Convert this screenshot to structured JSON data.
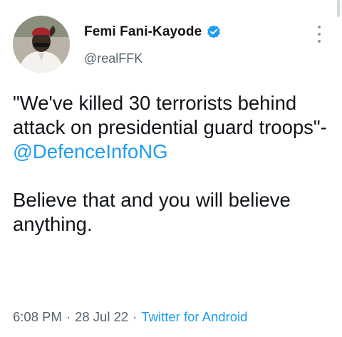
{
  "author": {
    "display_name": "Femi Fani-Kayode",
    "handle": "@realFFK",
    "verified": true
  },
  "tweet": {
    "quote": "\"We've killed 30 terrorists behind attack on presidential guard troops\"-",
    "mention": "@DefenceInfoNG",
    "paragraph_2": "Believe that and you will believe anything."
  },
  "meta": {
    "time": "6:08 PM",
    "separator": "·",
    "date": "28 Jul 22",
    "source": "Twitter for Android"
  },
  "icons": {
    "verified": "verified-badge-icon",
    "more": "more-vertical-icon"
  },
  "colors": {
    "text": "#0f1419",
    "secondary": "#536471",
    "accent": "#1d9bf0"
  }
}
